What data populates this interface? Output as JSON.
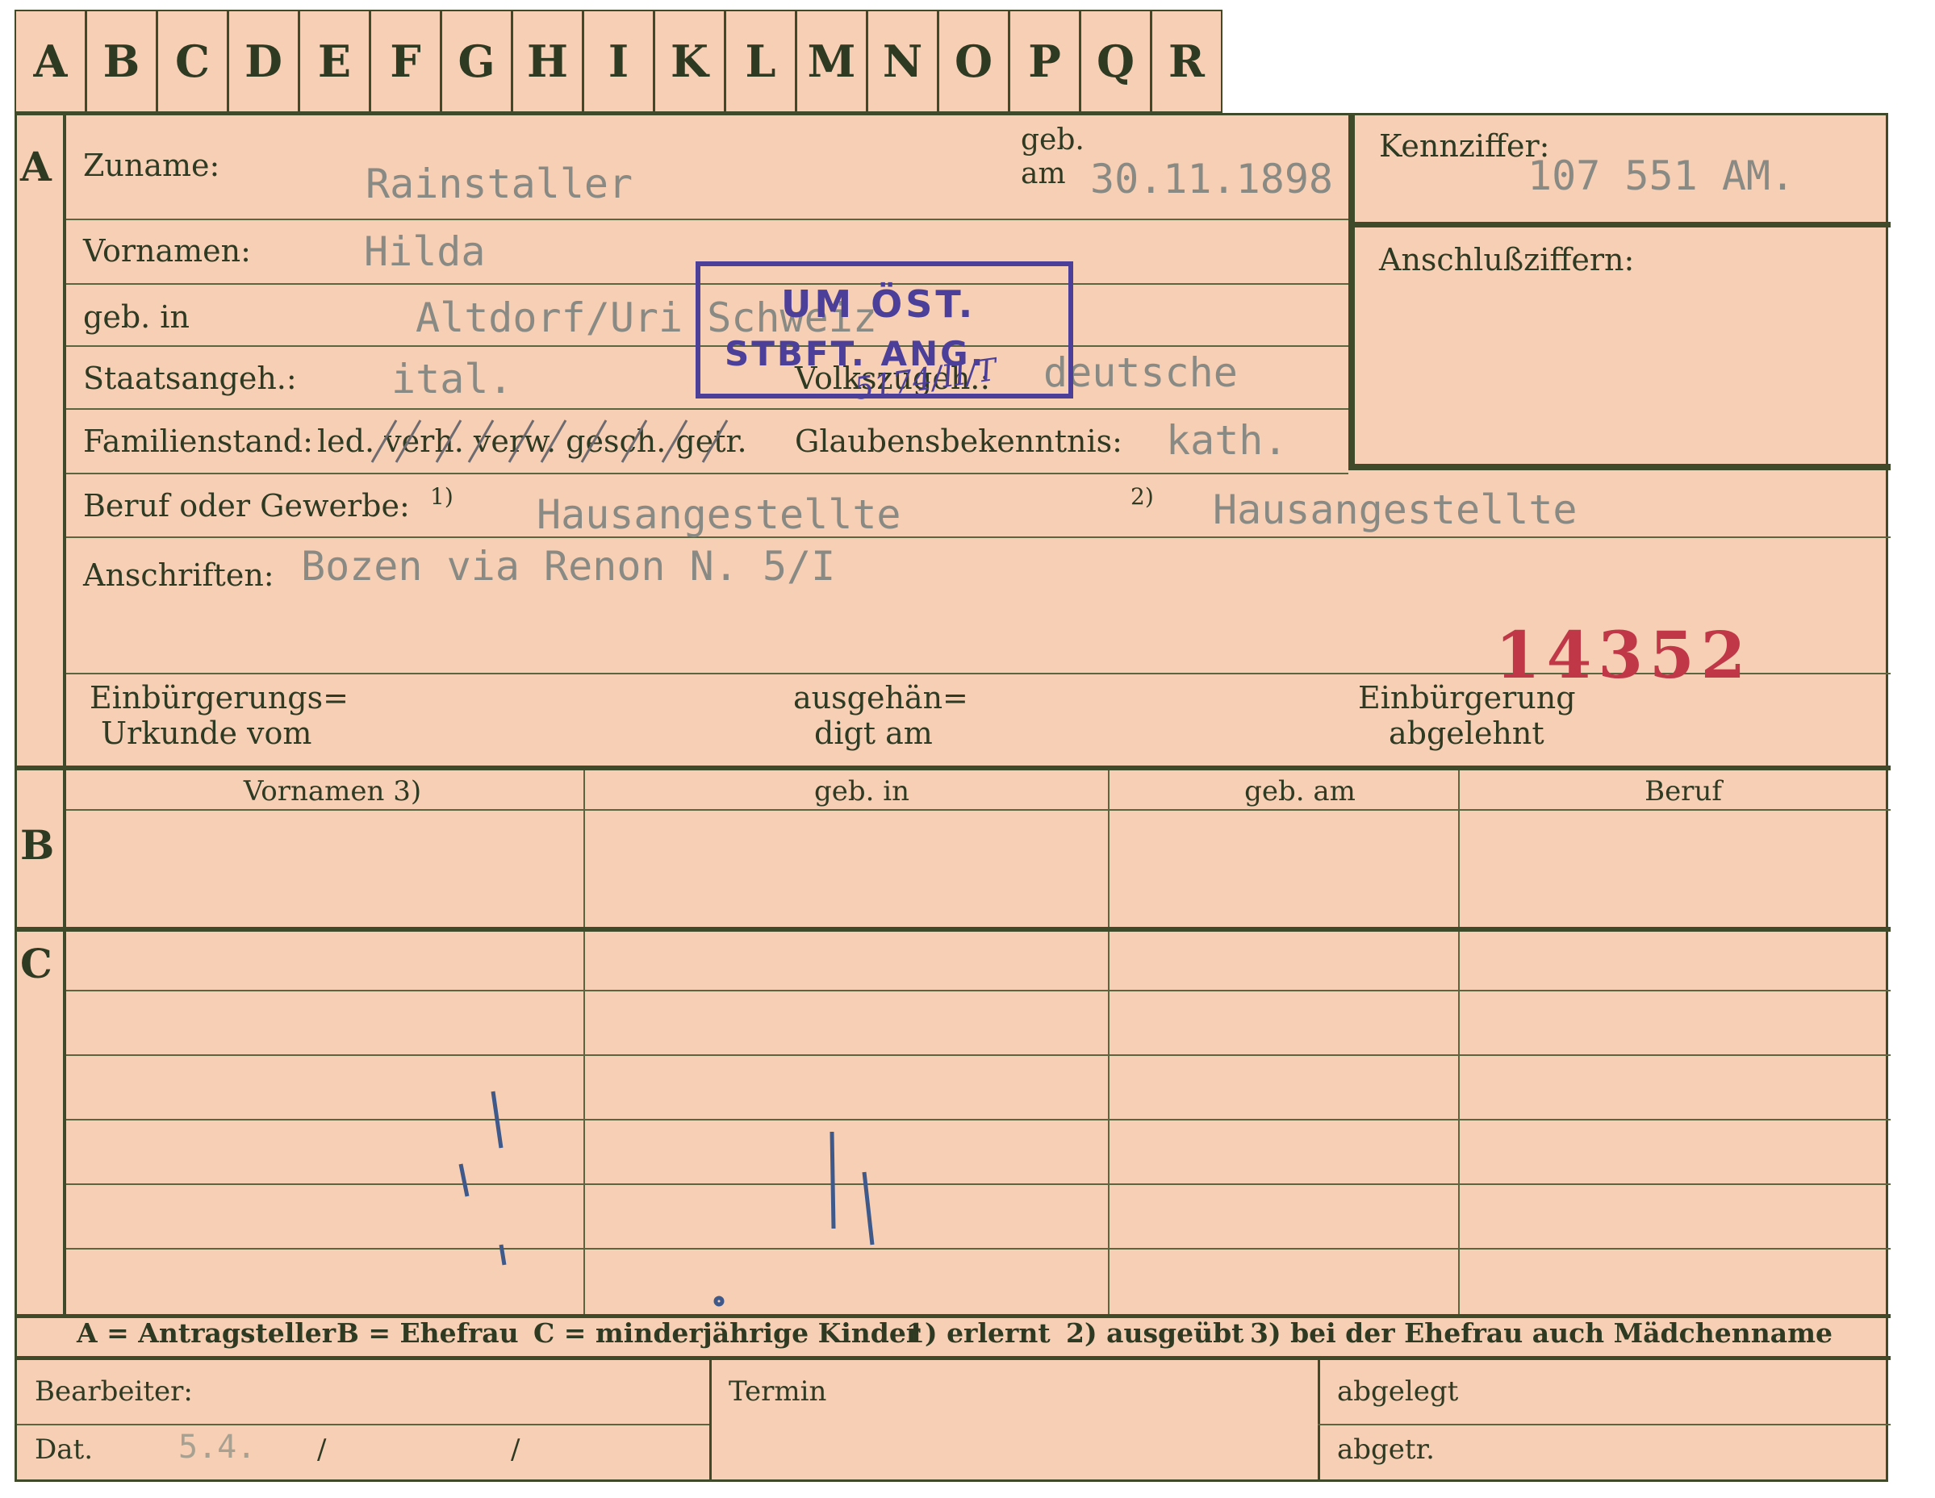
{
  "tabs": [
    "A",
    "B",
    "C",
    "D",
    "E",
    "F",
    "G",
    "H",
    "I",
    "K",
    "L",
    "M",
    "N",
    "O",
    "P",
    "Q",
    "R"
  ],
  "section_a": {
    "letter": "A",
    "zuname_label": "Zuname:",
    "zuname_value": "Rainstaller",
    "geb_label_1": "geb.",
    "geb_label_2": "am",
    "geb_value": "30.11.1898",
    "vornamen_label": "Vornamen:",
    "vornamen_value": "Hilda",
    "geb_in_label": "geb. in",
    "geb_in_value": "Altdorf/Uri Schweiz",
    "staatsangeh_label": "Staatsangeh.:",
    "staatsangeh_value": "ital.",
    "volkszugeh_label": "Volkszugeh.:",
    "volkszugeh_value": "deutsche",
    "familienstand_label": "Familienstand:",
    "familienstand_options": "led. verh. verw. gesch. getr.",
    "glaubens_label": "Glaubensbekenntnis:",
    "glaubens_value": "kath.",
    "beruf_label": "Beruf oder Gewerbe:",
    "beruf_sup1": "1)",
    "beruf_value1": "Hausangestellte",
    "beruf_sup2": "2)",
    "beruf_value2": "Hausangestellte",
    "anschriften_label": "Anschriften:",
    "anschriften_value": "Bozen via Renon N. 5/I",
    "red_number": "14352",
    "einb_label_1": "Einbürgerungs=",
    "einb_label_2": "Urkunde vom",
    "ausg_label_1": "ausgehän=",
    "ausg_label_2": "digt am",
    "abgel_label_1": "Einbürgerung",
    "abgel_label_2": "abgelehnt"
  },
  "right_box": {
    "kennziffer_label": "Kennziffer:",
    "kennziffer_value": "107 551 AM.",
    "anschluss_label": "Anschlußziffern:"
  },
  "stamp": {
    "line1": "UM ÖST.",
    "line2": "STBFT. ANG.",
    "handwritten": "5174/II/T"
  },
  "section_b": {
    "letter": "B",
    "headers": [
      "Vornamen 3)",
      "geb. in",
      "geb. am",
      "Beruf"
    ]
  },
  "section_c": {
    "letter": "C"
  },
  "legend": {
    "a": "A = Antragsteller",
    "b": "B = Ehefrau",
    "c": "C = minderjährige Kinder",
    "n1": "1) erlernt",
    "n2": "2) ausgeübt",
    "n3": "3) bei der Ehefrau auch Mädchenname"
  },
  "footer": {
    "bearbeiter_label": "Bearbeiter:",
    "termin_label": "Termin",
    "abgelegt_label": "abgelegt",
    "dat_label": "Dat.",
    "dat_value": "5.4.",
    "slash1": "/",
    "slash2": "/",
    "abgetr_label": "abgetr."
  },
  "colors": {
    "paper": "#f6cfb5",
    "ink_green": "#3f4a2a",
    "stamp_blue": "#4b3f9a",
    "red_number": "#c03848",
    "typewriter_gray": "#8a8a84"
  }
}
